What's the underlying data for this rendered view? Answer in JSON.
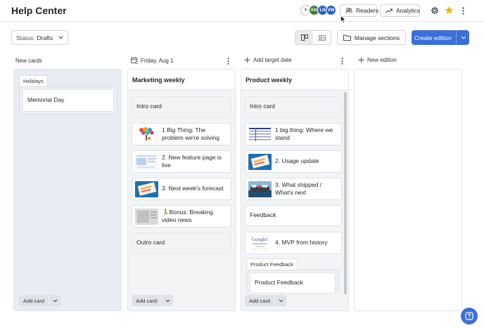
{
  "app": {
    "title": "Help Center"
  },
  "header": {
    "avatars": [
      {
        "initials": "+",
        "color": "#ffffff"
      },
      {
        "initials": "KN",
        "color": "#3f7d3a"
      },
      {
        "initials": "LN",
        "color": "#2a63c7"
      },
      {
        "initials": "VW",
        "color": "#2a63c7"
      }
    ],
    "readers_label": "Readers",
    "analytics_label": "Analytics"
  },
  "toolbar": {
    "status_label": "Status:",
    "status_value": "Drafts",
    "manage_sections_label": "Manage sections",
    "create_edition_label": "Create edition"
  },
  "columns": {
    "new_cards": {
      "header": "New cards",
      "group_label": "Holidays",
      "cards": [
        "Memorial Day"
      ],
      "add_card_label": "Add card"
    },
    "marketing": {
      "date": "Friday, Aug 1",
      "title": "Marketing weekly",
      "cards": [
        "Intro card",
        "1 Big Thing: The problem we're solving",
        "2. New feature page is live",
        "3. Next week's forecast",
        "🏃Bonus: Breaking video news",
        "Outro card"
      ],
      "add_card_label": "Add card"
    },
    "product": {
      "date_label": "Add target date",
      "title": "Product weekly",
      "cards": [
        "Intro card",
        "1 big thing: Where we stand",
        "2. Usage update",
        "3. What shipped / What's next",
        "Feedback",
        "4. MVP from history"
      ],
      "group_label": "Product Feedback",
      "group_cards": [
        "Product Feedback"
      ],
      "add_card_label": "Add card"
    },
    "new_edition": {
      "header": "New edition"
    }
  },
  "colors": {
    "accent": "#3b6fd8",
    "star": "#f2b705"
  }
}
